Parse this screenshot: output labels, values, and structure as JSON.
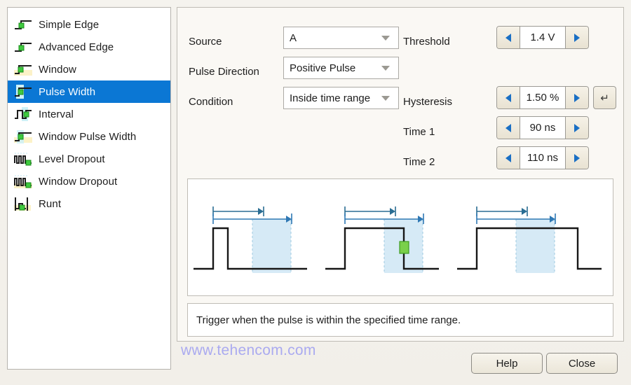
{
  "sidebar": {
    "items": [
      {
        "label": "Simple Edge",
        "icon": "edge-icon",
        "selected": false
      },
      {
        "label": "Advanced Edge",
        "icon": "advanced-edge-icon",
        "selected": false
      },
      {
        "label": "Window",
        "icon": "window-icon",
        "selected": false
      },
      {
        "label": "Pulse Width",
        "icon": "pulse-width-icon",
        "selected": true
      },
      {
        "label": "Interval",
        "icon": "interval-icon",
        "selected": false
      },
      {
        "label": "Window Pulse Width",
        "icon": "window-pulse-width-icon",
        "selected": false
      },
      {
        "label": "Level Dropout",
        "icon": "level-dropout-icon",
        "selected": false
      },
      {
        "label": "Window Dropout",
        "icon": "window-dropout-icon",
        "selected": false
      },
      {
        "label": "Runt",
        "icon": "runt-icon",
        "selected": false
      }
    ]
  },
  "form": {
    "source": {
      "label": "Source",
      "value": "A"
    },
    "pulse_direction": {
      "label": "Pulse Direction",
      "value": "Positive Pulse"
    },
    "condition": {
      "label": "Condition",
      "value": "Inside time range"
    },
    "threshold": {
      "label": "Threshold",
      "value": "1.4 V"
    },
    "hysteresis": {
      "label": "Hysteresis",
      "value": "1.50 %"
    },
    "time1": {
      "label": "Time 1",
      "value": "90 ns"
    },
    "time2": {
      "label": "Time 2",
      "value": "110 ns"
    },
    "reset_icon": "undo-icon"
  },
  "description": {
    "text": "Trigger when the pulse is within the specified time range."
  },
  "watermark": {
    "text": "www.tehencom.com"
  },
  "buttons": {
    "help": "Help",
    "close": "Close"
  },
  "colors": {
    "selection": "#0b77d4",
    "arrow_blue": "#1a6fc4",
    "marker_green": "#7ad04a",
    "band_fill": "#d6eaf6",
    "watermark": "#aaaaf0"
  }
}
